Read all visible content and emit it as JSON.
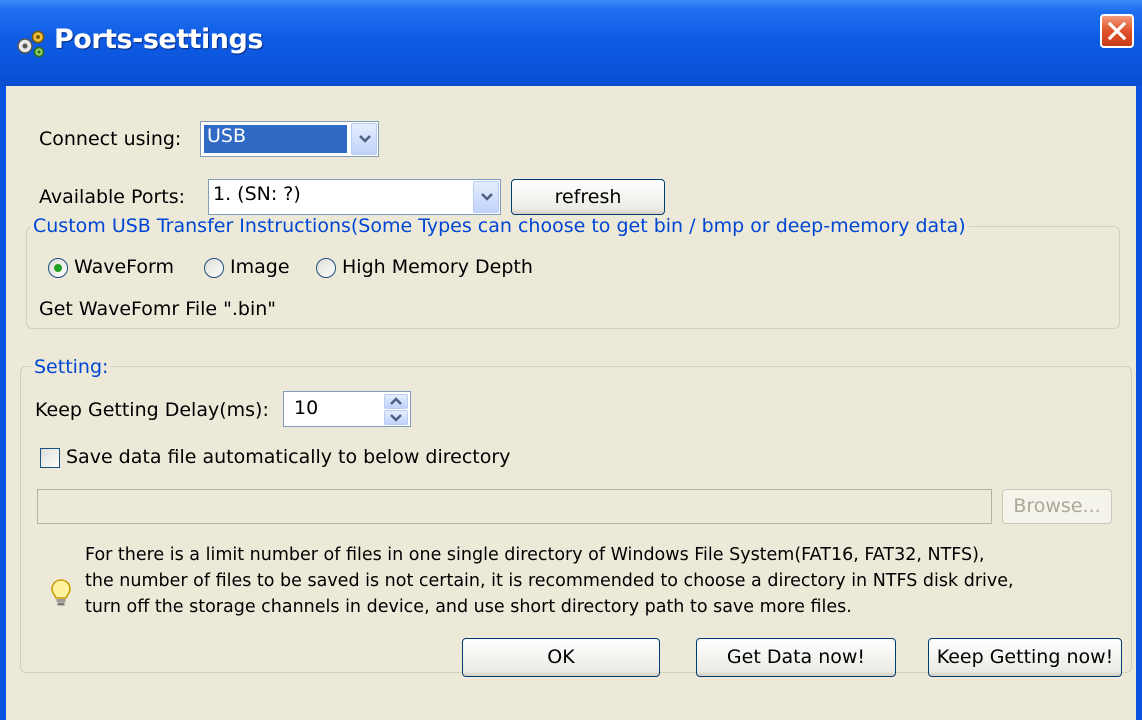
{
  "window": {
    "title": "Ports-settings",
    "title_icon": "gears-icon",
    "close_icon": "close-icon"
  },
  "connect": {
    "label": "Connect using:",
    "value": "USB"
  },
  "ports": {
    "label": "Available Ports:",
    "value": "1. (SN: ?)",
    "refresh_label": "refresh"
  },
  "usb_group": {
    "title": "Custom USB Transfer Instructions(Some Types can choose to get bin / bmp or deep-memory data)",
    "options": [
      {
        "label": "WaveForm",
        "selected": true
      },
      {
        "label": "Image",
        "selected": false
      },
      {
        "label": "High Memory Depth",
        "selected": false
      }
    ],
    "info": "Get WaveFomr File \".bin\""
  },
  "setting_group": {
    "title": "Setting:",
    "delay_label": "Keep Getting Delay(ms):",
    "delay_value": "10",
    "autosave_label": "Save data file automatically to below directory",
    "autosave_checked": false,
    "directory_value": "",
    "browse_label": "Browse...",
    "note_icon": "lightbulb-icon",
    "note_lines": [
      "For there is a limit number of files in one single directory of Windows File System(FAT16, FAT32, NTFS),",
      "the number of  files to be saved is not certain,  it is recommended to choose a directory in NTFS disk drive,",
      "turn off the storage channels in device, and use short directory path to save more files."
    ]
  },
  "buttons": {
    "ok": "OK",
    "get_data": "Get Data now!",
    "keep_getting": "Keep Getting now!"
  },
  "colors": {
    "title_bar": "#0a53e0",
    "dialog_bg": "#ece9d8",
    "group_title": "#0046d5",
    "selection": "#316ac5",
    "close_button": "#e0532b"
  }
}
